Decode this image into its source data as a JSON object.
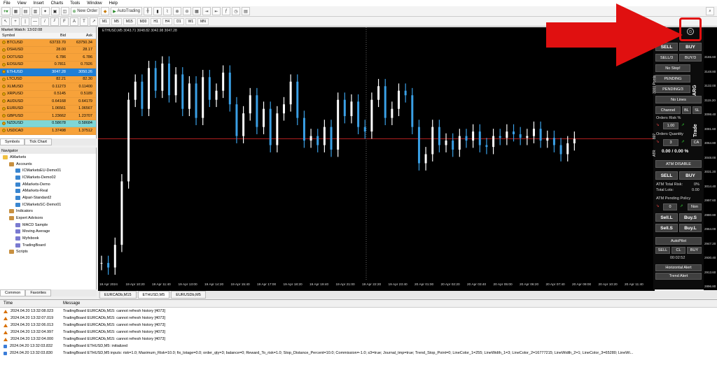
{
  "menu": [
    "File",
    "View",
    "Insert",
    "Charts",
    "Tools",
    "Window",
    "Help"
  ],
  "toolbar": {
    "new_order": "New Order",
    "autotrading": "AutoTrading"
  },
  "timeframes": [
    "M1",
    "M5",
    "M15",
    "M30",
    "H1",
    "H4",
    "D1",
    "W1",
    "MN"
  ],
  "market_watch": {
    "title": "Market Watch: 13:02:08",
    "col_symbol": "Symbol",
    "col_bid": "Bid",
    "col_ask": "Ask",
    "rows": [
      {
        "symbol": "BTCUSD",
        "bid": "63733.70",
        "ask": "63750.34",
        "bg": "#f7a23a"
      },
      {
        "symbol": "DSHUSD",
        "bid": "28.00",
        "ask": "28.17",
        "bg": "#f7a23a"
      },
      {
        "symbol": "DOTUSD",
        "bid": "6.786",
        "ask": "6.786",
        "bg": "#f7a23a"
      },
      {
        "symbol": "EOSUSD",
        "bid": "0.7811",
        "ask": "0.7926",
        "bg": "#f7a23a"
      },
      {
        "symbol": "ETHUSD",
        "bid": "3047.28",
        "ask": "3050.26",
        "bg": "#1f7fd6"
      },
      {
        "symbol": "LTCUSD",
        "bid": "82.21",
        "ask": "82.30",
        "bg": "#f7a23a"
      },
      {
        "symbol": "XLMUSD",
        "bid": "0.11273",
        "ask": "0.11400",
        "bg": "#f7a23a"
      },
      {
        "symbol": "XRPUSD",
        "bid": "0.5145",
        "ask": "0.5189",
        "bg": "#f7a23a"
      },
      {
        "symbol": "AUDUSD",
        "bid": "0.64168",
        "ask": "0.64179",
        "bg": "#f7a23a"
      },
      {
        "symbol": "EURUSD",
        "bid": "1.06561",
        "ask": "1.06567",
        "bg": "#f7a23a"
      },
      {
        "symbol": "GBPUSD",
        "bid": "1.23662",
        "ask": "1.23707",
        "bg": "#f7a23a"
      },
      {
        "symbol": "NZDUSD",
        "bid": "0.58678",
        "ask": "0.58684",
        "bg": "#7fd6d6"
      },
      {
        "symbol": "USDCAD",
        "bid": "1.37498",
        "ask": "1.37512",
        "bg": "#f7a23a"
      }
    ],
    "tabs": [
      "Symbols",
      "Tick Chart"
    ]
  },
  "navigator": {
    "title": "Navigator",
    "items": [
      {
        "label": "AMarkets",
        "indent": 0,
        "color": "#f0c040"
      },
      {
        "label": "Accounts",
        "indent": 1,
        "color": "#c89040"
      },
      {
        "label": "ICMarketsEU-Demo01",
        "indent": 2,
        "color": "#3a86d0"
      },
      {
        "label": "ICMarkets-Demo02",
        "indent": 2,
        "color": "#3a86d0"
      },
      {
        "label": "AMarkets-Demo",
        "indent": 2,
        "color": "#3a86d0"
      },
      {
        "label": "AMarkets-Real",
        "indent": 2,
        "color": "#3a86d0"
      },
      {
        "label": "Alpari-Standard2",
        "indent": 2,
        "color": "#3a86d0"
      },
      {
        "label": "ICMarketsSC-Demo01",
        "indent": 2,
        "color": "#3a86d0"
      },
      {
        "label": "Indicators",
        "indent": 1,
        "color": "#c89040"
      },
      {
        "label": "Expert Advisors",
        "indent": 1,
        "color": "#c89040"
      },
      {
        "label": "MACD Sample",
        "indent": 2,
        "color": "#7a7ad0"
      },
      {
        "label": "Moving Average",
        "indent": 2,
        "color": "#7a7ad0"
      },
      {
        "label": "Myfxbook",
        "indent": 2,
        "color": "#7a7ad0"
      },
      {
        "label": "TradingBoard",
        "indent": 2,
        "color": "#7a7ad0"
      },
      {
        "label": "Scripts",
        "indent": 1,
        "color": "#c89040"
      }
    ],
    "tabs": [
      "Common",
      "Favorites"
    ]
  },
  "chart": {
    "title": "ETHUSD,M5  3043.71 3048.82 3042.98 3047.28",
    "tabs": [
      "EURCADb,M15",
      "ETHUSD,M5",
      "EURUSDb,M5"
    ],
    "active_tab": 1,
    "x_labels": [
      "19 Apr 2024",
      "19 Apr 10:20",
      "19 Apr 11:40",
      "19 Apr 13:00",
      "19 Apr 14:20",
      "19 Apr 15:40",
      "19 Apr 17:00",
      "19 Apr 18:20",
      "19 Apr 19:40",
      "19 Apr 21:00",
      "19 Apr 22:20",
      "19 Apr 23:40",
      "20 Apr 01:00",
      "20 Apr 02:20",
      "20 Apr 03:40",
      "20 Apr 05:00",
      "20 Apr 06:20",
      "20 Apr 07:40",
      "20 Apr 09:00",
      "20 Apr 10:20",
      "20 Apr 11:40"
    ],
    "y_labels": [
      "3165.60",
      "3148.80",
      "3132.00",
      "3115.20",
      "3098.40",
      "3081.60",
      "3064.80",
      "3048.00",
      "3031.20",
      "3014.40",
      "2997.60",
      "2980.80",
      "2964.00",
      "2947.20",
      "2930.40",
      "2913.60",
      "2896.80"
    ],
    "price_line_color": "#b02020"
  },
  "chart_data": {
    "type": "line",
    "series": [
      {
        "values": [
          2910,
          2905,
          2930,
          3000,
          3090,
          3110,
          3080,
          3125,
          3100,
          3130,
          3095,
          3118,
          3080,
          3108,
          3070,
          3115,
          3090,
          3100,
          3120,
          3085,
          3050,
          3075,
          3095,
          3060,
          3080,
          3040,
          3075,
          3085,
          3110,
          3070,
          3045,
          3050,
          3040,
          3060,
          3035,
          3090,
          3072,
          3088,
          3060,
          3055,
          3090,
          3105,
          3070,
          3080,
          3100,
          3095,
          3060,
          3020,
          3030,
          3060,
          3040,
          3045,
          3035,
          3050,
          3045,
          3055,
          3040,
          3038,
          3050,
          3048,
          3055,
          3052,
          3048,
          3050,
          3058,
          3045,
          3048,
          3040,
          3030,
          3042,
          3047
        ]
      }
    ]
  },
  "panel": {
    "sell": "SELL",
    "buy": "BUY",
    "sell3": "SELL/3",
    "buy3": "BUY/3",
    "nostop": "No Stop!",
    "pending": "PENDING",
    "pending3": "PENDING/3",
    "nolines": "No Lines",
    "channel": "Channel",
    "bl": "BL",
    "sl": "SL",
    "orders_risk": "Orders Risk %",
    "risk_val": "1.00",
    "orders_qty": "Orders Quantity",
    "qty_val": "3",
    "ca": "CA",
    "pct": "0.00 / 0.00 %",
    "atm_disable": "ATM DISABLE",
    "sell2": "SELL",
    "buy2": "BUY",
    "atm_total_risk": "ATM Total Risk:",
    "atm_total_risk_val": "0%",
    "total_lots": "Total Lots:",
    "total_lots_val": "0.00",
    "atm_pending": "ATM Pending Policy",
    "pend_val": "0",
    "non": "Non",
    "selll": "Sell.L",
    "buys": "Buy.S",
    "sells": "Sell.S",
    "buyl": "Buy.L",
    "autopilot": "AutoPilot",
    "ap_sell": "SELL",
    "ap_cl": "CL",
    "ap_buy": "BUY",
    "timer": "00:02:52",
    "horiz": "Horizontal Alert",
    "trend": "Trend Alert",
    "side_arg": "ARG",
    "side_trade": "Trade",
    "side_pos": "3000 Points",
    "side_k": "K",
    "side_807": "807",
    "side_atr": "ATR"
  },
  "log": {
    "col_time": "Time",
    "col_message": "Message",
    "rows": [
      {
        "time": "2024.04.20 13:32:08.023",
        "msg": "TradingBoard EURCADb,M15: cannot refresh history [4073]",
        "type": "warn"
      },
      {
        "time": "2024.04.20 13:32:07.019",
        "msg": "TradingBoard EURCADb,M15: cannot refresh history [4073]",
        "type": "warn"
      },
      {
        "time": "2024.04.20 13:32:06.013",
        "msg": "TradingBoard EURCADb,M15: cannot refresh history [4073]",
        "type": "warn"
      },
      {
        "time": "2024.04.20 13:32:04.997",
        "msg": "TradingBoard EURCADb,M15: cannot refresh history [4073]",
        "type": "warn"
      },
      {
        "time": "2024.04.20 13:32:04.000",
        "msg": "TradingBoard EURCADb,M15: cannot refresh history [4073]",
        "type": "warn"
      },
      {
        "time": "2024.04.20 13:32:03.832",
        "msg": "TradingBoard ETHUSD,M5: initialized",
        "type": "info"
      },
      {
        "time": "2024.04.20 13:32:03.830",
        "msg": "TradingBoard ETHUSD,M5 inputs: risk=1.0;  Maximum_Risk=10.0;  fix_lotage=0.0;  order_qty=3;  balance=0;  Reward_To_risk=1.0;  Stop_Distance_Percent=10.0;  Commission=-1.0;  s3=true;  Journal_tmp=true;  Trend_Stop_Point=0;  LineColor_1=255;  LineWidth_1=3;  LineColor_2=16777215;  LineWidth_2=1;  LineColor_3=65280;  LineWi...",
        "type": "info"
      }
    ]
  },
  "colors": {
    "annotation": "#e01010",
    "arrow": "#e01010"
  }
}
